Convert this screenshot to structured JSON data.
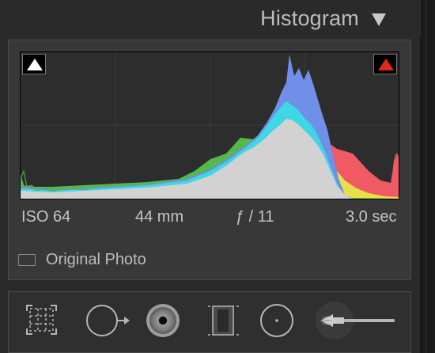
{
  "panel": {
    "title": "Histogram"
  },
  "histogram": {
    "exif": {
      "iso": "ISO 64",
      "focal_length": "44 mm",
      "aperture": "ƒ / 11",
      "shutter": "3.0 sec"
    },
    "original_photo_label": "Original Photo",
    "original_photo_checked": false,
    "shadow_clipping": "off",
    "highlight_clipping": "on"
  },
  "colors": {
    "highlight_clip": "#e0281d",
    "shadow_clip": "#ffffff",
    "gray_channel": "#d2d2d2",
    "blue_channel": "#6f8fe8",
    "cyan_channel": "#3fd7e6",
    "magenta_channel": "#d040d2",
    "red_channel": "#ef5a63",
    "yellow_channel": "#e8e04a",
    "green_channel": "#55b84c"
  },
  "toolbar": {
    "tools": [
      {
        "name": "crop-overlay",
        "icon": "crop-icon"
      },
      {
        "name": "spot-removal",
        "icon": "spot-removal-icon"
      },
      {
        "name": "red-eye-correction",
        "icon": "red-eye-icon"
      },
      {
        "name": "graduated-filter",
        "icon": "graduated-filter-icon"
      },
      {
        "name": "radial-filter",
        "icon": "radial-filter-icon"
      },
      {
        "name": "adjustment-brush",
        "icon": "adjustment-brush-icon"
      }
    ]
  }
}
